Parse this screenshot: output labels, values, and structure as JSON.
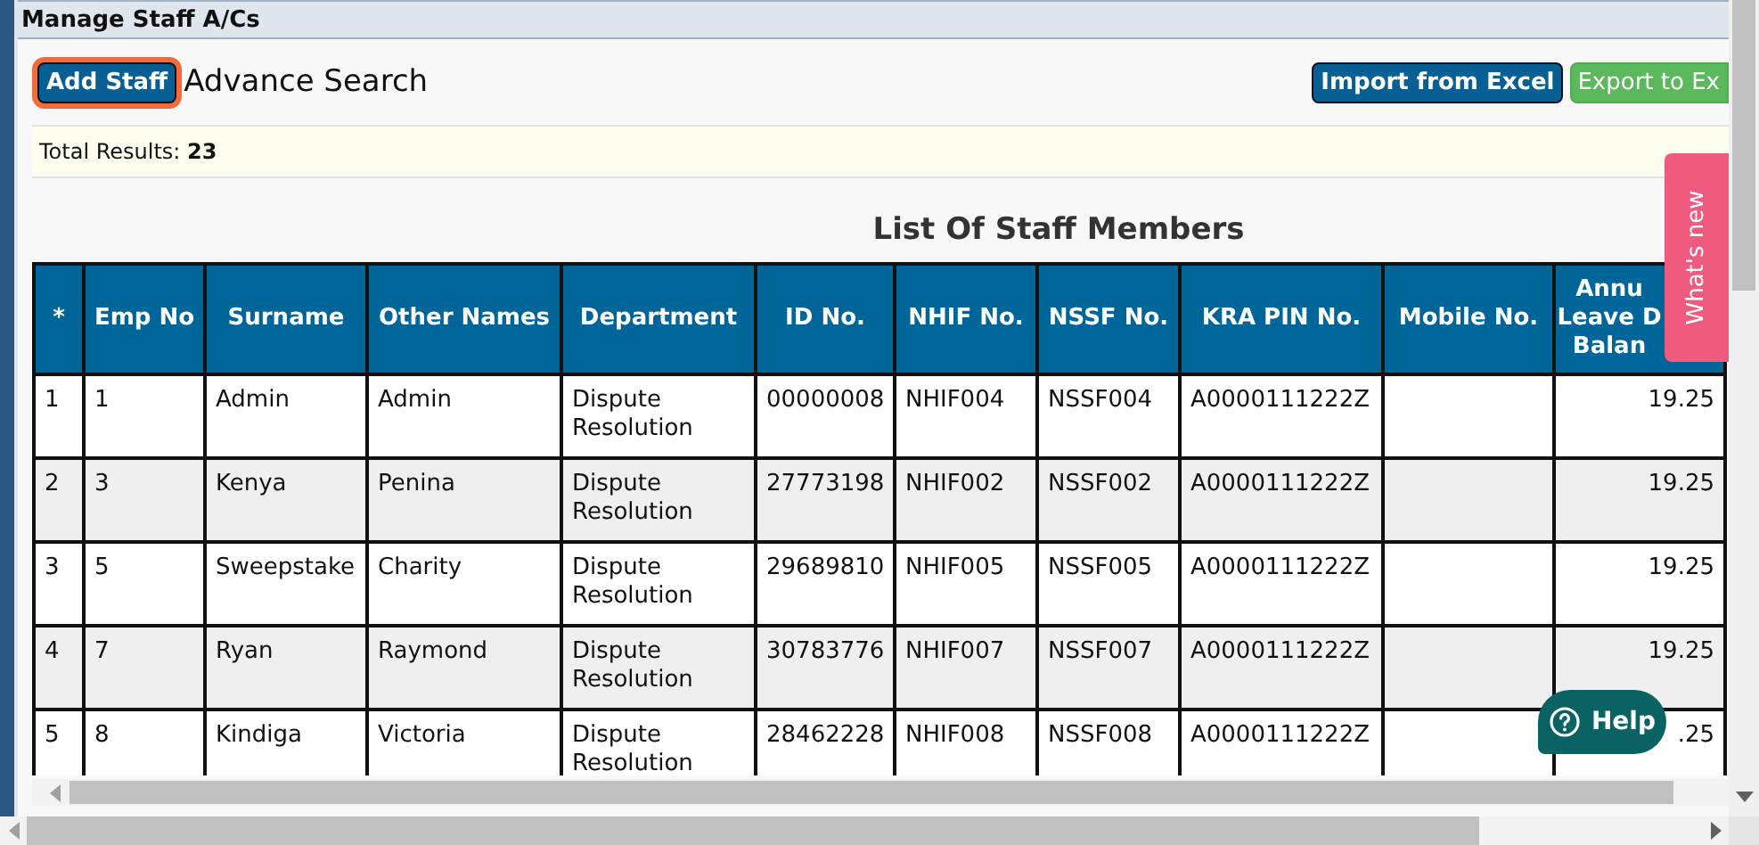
{
  "panel": {
    "title": "Manage Staff A/Cs"
  },
  "toolbar": {
    "left_buttons": [
      {
        "label": "Add Staff",
        "kind": "primary",
        "focused": true
      },
      {
        "label": "Advance Search",
        "kind": "link",
        "focused": false
      }
    ],
    "right_buttons": [
      {
        "label": "Import from Excel",
        "kind": "primary",
        "focused": false
      },
      {
        "label": "Export to Ex",
        "kind": "success",
        "focused": false
      }
    ]
  },
  "summary": {
    "label": "Total Results:",
    "value": "23"
  },
  "table": {
    "title": "List Of Staff Members",
    "columns": [
      "*",
      "Emp No",
      "Surname",
      "Other Names",
      "Department",
      "ID No.",
      "NHIF No.",
      "NSSF No.",
      "KRA PIN No.",
      "Mobile No.",
      "Annu\nLeave D\nBalan"
    ],
    "rows": [
      [
        "1",
        "1",
        "Admin",
        "Admin",
        "Dispute Resolution",
        "00000008",
        "NHIF004",
        "NSSF004",
        "A0000111222Z",
        null,
        "19.25"
      ],
      [
        "2",
        "3",
        "Kenya",
        "Penina",
        "Dispute Resolution",
        "27773198",
        "NHIF002",
        "NSSF002",
        "A0000111222Z",
        null,
        "19.25"
      ],
      [
        "3",
        "5",
        "Sweepstake",
        "Charity",
        "Dispute Resolution",
        "29689810",
        "NHIF005",
        "NSSF005",
        "A0000111222Z",
        null,
        "19.25"
      ],
      [
        "4",
        "7",
        "Ryan",
        "Raymond",
        "Dispute Resolution",
        "30783776",
        "NHIF007",
        "NSSF007",
        "A0000111222Z",
        null,
        "19.25"
      ],
      [
        "5",
        "8",
        "Kindiga",
        "Victoria",
        "Dispute Resolution",
        "28462228",
        "NHIF008",
        "NSSF008",
        "A0000111222Z",
        null,
        ".25"
      ]
    ]
  },
  "whats_new": {
    "label": "What's new"
  },
  "help": {
    "label": "Help"
  }
}
